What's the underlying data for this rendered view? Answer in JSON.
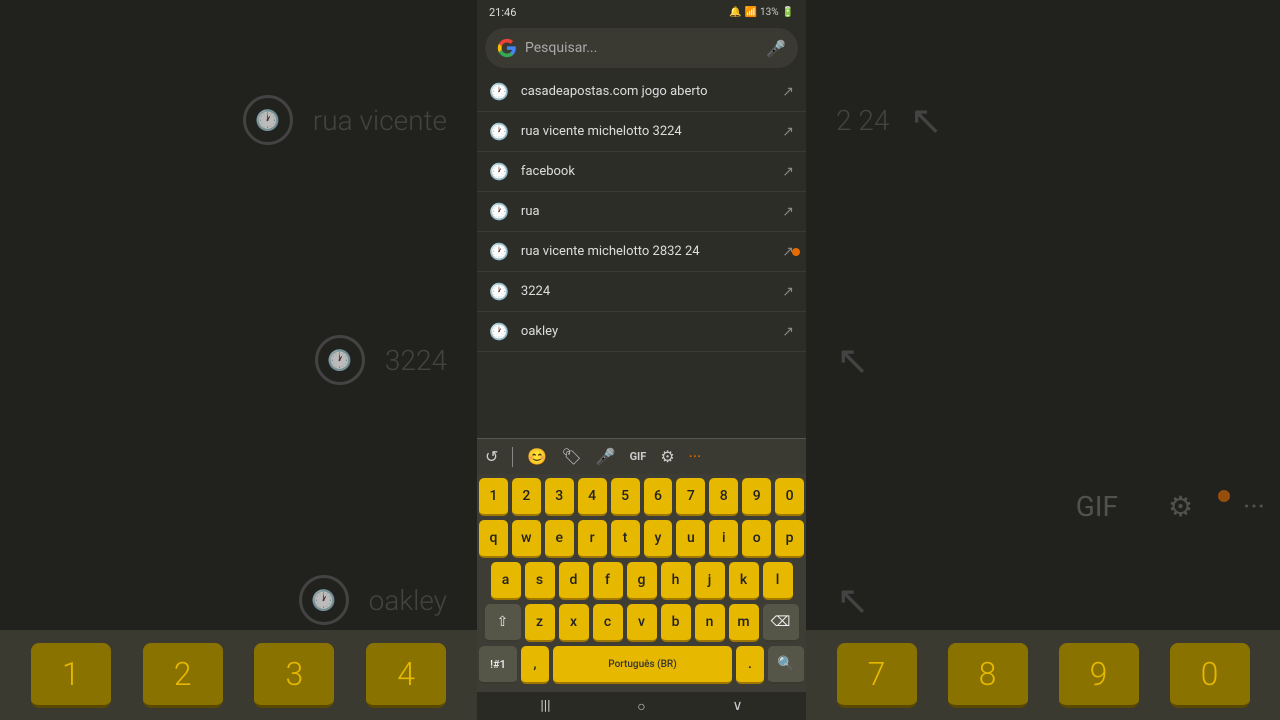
{
  "status": {
    "time": "21:46",
    "battery": "13%",
    "icons": "🔔 📶 🔋"
  },
  "search": {
    "placeholder": "Pesquisar...",
    "mic_label": "🎤"
  },
  "suggestions": [
    {
      "text": "casadeapostas.com jogo aberto",
      "icon": "🕐",
      "arrow": "↗"
    },
    {
      "text": "rua vicente michelotto 3224",
      "icon": "🕐",
      "arrow": "↗"
    },
    {
      "text": "facebook",
      "icon": "🕐",
      "arrow": "↗"
    },
    {
      "text": "rua",
      "icon": "🕐",
      "arrow": "↗"
    },
    {
      "text": "rua vicente michelotto 2832 24",
      "icon": "🕐",
      "arrow": "↗",
      "has_dot": true
    },
    {
      "text": "3224",
      "icon": "🕐",
      "arrow": "↗"
    },
    {
      "text": "oakley",
      "icon": "🕐",
      "arrow": "↗"
    }
  ],
  "keyboard": {
    "toolbar": {
      "undo": "↺",
      "emoji": "😊",
      "sticker": "🏷",
      "mic": "🎤",
      "gif": "GIF",
      "settings": "⚙",
      "more": "···"
    },
    "rows": {
      "numbers": [
        "1",
        "2",
        "3",
        "4",
        "5",
        "6",
        "7",
        "8",
        "9",
        "0"
      ],
      "row1": [
        "q",
        "w",
        "e",
        "r",
        "t",
        "y",
        "u",
        "i",
        "o",
        "p"
      ],
      "row2": [
        "a",
        "s",
        "d",
        "f",
        "g",
        "h",
        "j",
        "k",
        "l"
      ],
      "row3": [
        "z",
        "x",
        "c",
        "v",
        "b",
        "n",
        "m"
      ],
      "shift": "⇧",
      "backspace": "⌫",
      "special": "!#1",
      "comma": ",",
      "space": "Português (BR)",
      "period": ".",
      "search": "🔍"
    }
  },
  "navbar": {
    "menu": "|||",
    "home": "○",
    "back": "∨"
  },
  "bg": {
    "left_items": [
      {
        "clock": true,
        "text": "rua vicente"
      },
      {
        "clock": true,
        "text": "3224"
      },
      {
        "clock": true,
        "text": "oakley"
      }
    ],
    "right_arrows": [
      "↖",
      "↖",
      "↖"
    ],
    "bg_text_right": "2 24",
    "bottom_keys_left": [
      "1",
      "2",
      "3",
      "4"
    ],
    "bottom_keys_right": [
      "7",
      "8",
      "9",
      "0"
    ]
  }
}
